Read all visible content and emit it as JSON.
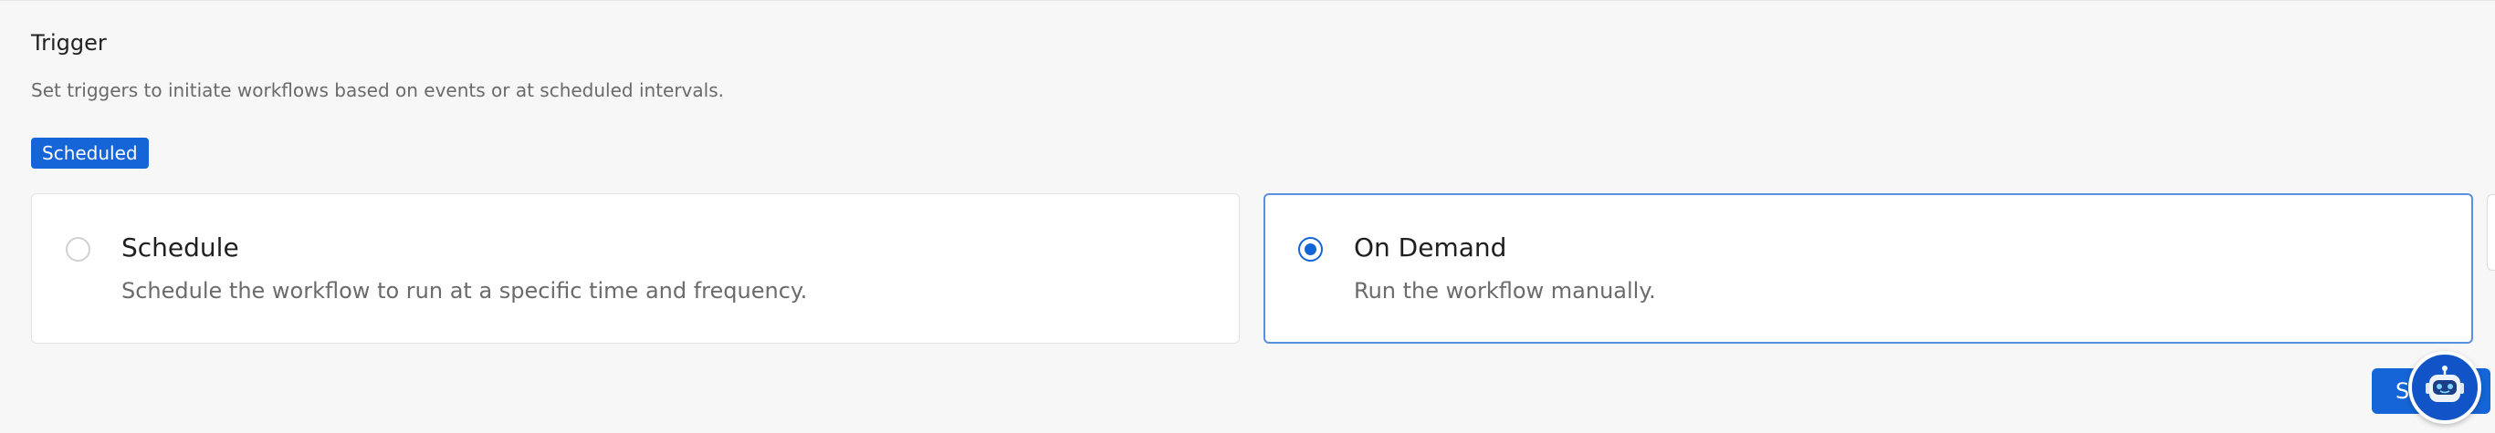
{
  "trigger": {
    "title": "Trigger",
    "description": "Set triggers to initiate workflows based on events or at scheduled intervals.",
    "tag": "Scheduled"
  },
  "options": [
    {
      "title": "Schedule",
      "description": "Schedule the workflow to run at a specific time and frequency.",
      "selected": false
    },
    {
      "title": "On Demand",
      "description": "Run the workflow manually.",
      "selected": true
    }
  ],
  "footer": {
    "primary_button_label": "S"
  },
  "colors": {
    "accent": "#1565d8",
    "selected_border": "#5b8fe0",
    "background": "#f7f7f7"
  },
  "icons": {
    "assistant": "robot-icon"
  }
}
